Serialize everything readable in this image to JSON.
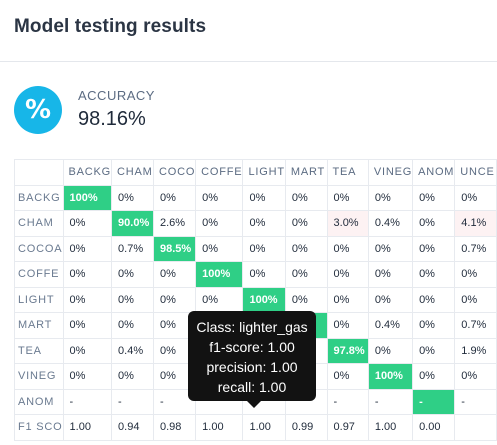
{
  "header": {
    "title": "Model testing results"
  },
  "accuracy": {
    "icon": "percent-icon",
    "icon_glyph": "%",
    "label": "ACCURACY",
    "value": "98.16%",
    "icon_color": "#17b6e8"
  },
  "matrix": {
    "columns": [
      "BACKG",
      "CHAM",
      "COCO",
      "COFFE",
      "LIGHT",
      "MART",
      "TEA",
      "VINEG",
      "ANOM",
      "UNCE"
    ],
    "rows": [
      {
        "label": "BACKG",
        "cells": [
          "100%",
          "0%",
          "0%",
          "0%",
          "0%",
          "0%",
          "0%",
          "0%",
          "0%",
          "0%"
        ]
      },
      {
        "label": "CHAM",
        "cells": [
          "0%",
          "90.0%",
          "2.6%",
          "0%",
          "0%",
          "0%",
          "3.0%",
          "0.4%",
          "0%",
          "4.1%"
        ]
      },
      {
        "label": "COCOA",
        "cells": [
          "0%",
          "0.7%",
          "98.5%",
          "0%",
          "0%",
          "0%",
          "0%",
          "0%",
          "0%",
          "0.7%"
        ]
      },
      {
        "label": "COFFE",
        "cells": [
          "0%",
          "0%",
          "0%",
          "100%",
          "0%",
          "0%",
          "0%",
          "0%",
          "0%",
          "0%"
        ]
      },
      {
        "label": "LIGHT",
        "cells": [
          "0%",
          "0%",
          "0%",
          "0%",
          "100%",
          "0%",
          "0%",
          "0%",
          "0%",
          "0%"
        ]
      },
      {
        "label": "MART",
        "cells": [
          "0%",
          "0%",
          "0%",
          "",
          "",
          "",
          "0%",
          "0.4%",
          "0%",
          "0.7%"
        ]
      },
      {
        "label": "TEA",
        "cells": [
          "0%",
          "0.4%",
          "0%",
          "",
          "",
          "",
          "97.8%",
          "0%",
          "0%",
          "1.9%"
        ]
      },
      {
        "label": "VINEG",
        "cells": [
          "0%",
          "0%",
          "0%",
          "",
          "",
          "",
          "0%",
          "100%",
          "0%",
          "0%"
        ]
      },
      {
        "label": "ANOM",
        "cells": [
          "-",
          "-",
          "-",
          "",
          "",
          "",
          "-",
          "-",
          "-",
          "-"
        ]
      }
    ],
    "f1": {
      "label": "F1 SCO",
      "cells": [
        "1.00",
        "0.94",
        "0.98",
        "1.00",
        "1.00",
        "0.99",
        "0.97",
        "1.00",
        "0.00",
        ""
      ]
    },
    "colors": {
      "diagonal": "#2fcf86",
      "highlight": "#fdf2f3"
    }
  },
  "tooltip": {
    "class_line": "Class: lighter_gas",
    "f1_line": "f1-score: 1.00",
    "precision_line": "precision: 1.00",
    "recall_line": "recall: 1.00"
  }
}
